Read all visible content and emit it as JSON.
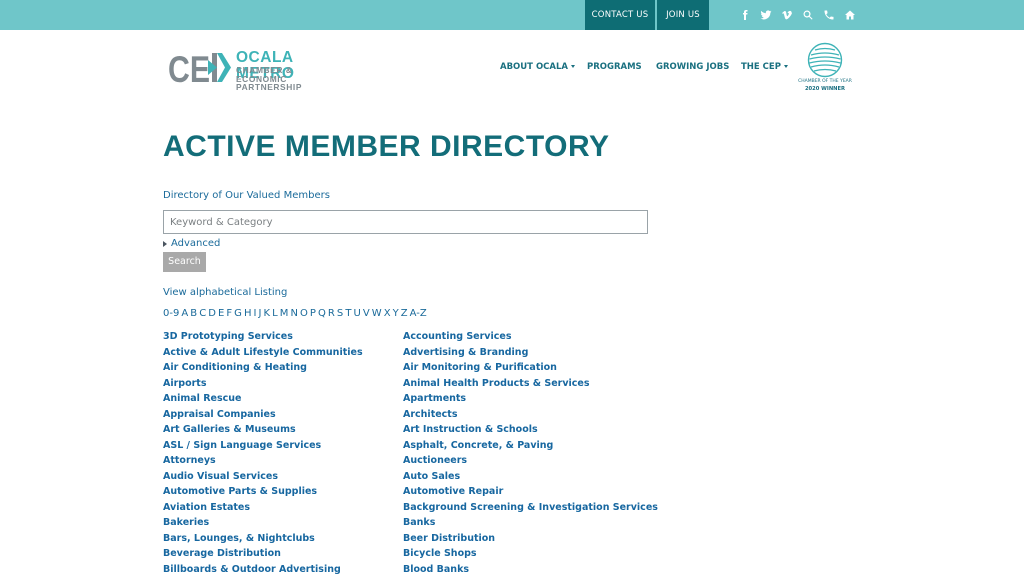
{
  "topbar": {
    "contact": "CONTACT US",
    "join": "JOIN US",
    "icons": [
      "facebook-icon",
      "twitter-icon",
      "vimeo-icon",
      "search-icon",
      "phone-icon",
      "home-icon"
    ]
  },
  "logo": {
    "mark": "CEP",
    "name": "OCALA METRO",
    "sub": "CHAMBER & ECONOMIC PARTNERSHIP"
  },
  "nav": {
    "about": "ABOUT OCALA",
    "programs": "PROGRAMS",
    "jobs": "GROWING JOBS",
    "cep": "THE CEP"
  },
  "award": {
    "line1": "CHAMBER OF THE YEAR",
    "line2": "2020 WINNER"
  },
  "main": {
    "title": "ACTIVE MEMBER DIRECTORY",
    "subtitle": "Directory of Our Valued Members",
    "search_placeholder": "Keyword & Category",
    "advanced": "Advanced",
    "search_button": "Search",
    "alpha_link": "View alphabetical Listing",
    "letters": [
      "0-9",
      "A",
      "B",
      "C",
      "D",
      "E",
      "F",
      "G",
      "H",
      "I",
      "J",
      "K",
      "L",
      "M",
      "N",
      "O",
      "P",
      "Q",
      "R",
      "S",
      "T",
      "U",
      "V",
      "W",
      "X",
      "Y",
      "Z",
      "A-Z"
    ],
    "categories_col1": [
      "3D Prototyping Services",
      "Active & Adult Lifestyle Communities",
      "Air Conditioning & Heating",
      "Airports",
      "Animal Rescue",
      "Appraisal Companies",
      "Art Galleries & Museums",
      "ASL / Sign Language Services",
      "Attorneys",
      "Audio Visual Services",
      "Automotive Parts & Supplies",
      "Aviation Estates",
      "Bakeries",
      "Bars, Lounges, & Nightclubs",
      "Beverage Distribution",
      "Billboards & Outdoor Advertising"
    ],
    "categories_col2": [
      "Accounting Services",
      "Advertising & Branding",
      "Air Monitoring & Purification",
      "Animal Health Products & Services",
      "Apartments",
      "Architects",
      "Art Instruction & Schools",
      "Asphalt, Concrete, & Paving",
      "Auctioneers",
      "Auto Sales",
      "Automotive Repair",
      "Background Screening & Investigation Services",
      "Banks",
      "Beer Distribution",
      "Bicycle Shops",
      "Blood Banks"
    ]
  }
}
